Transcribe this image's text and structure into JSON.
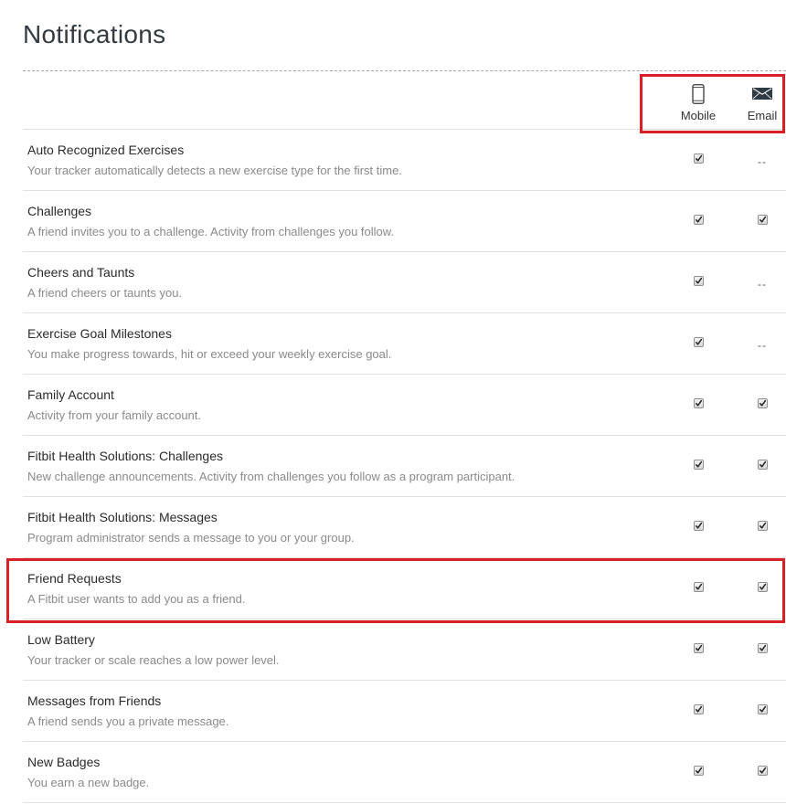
{
  "page": {
    "title": "Notifications"
  },
  "columns": {
    "mobile": {
      "label": "Mobile",
      "icon": "mobile-phone-icon"
    },
    "email": {
      "label": "Email",
      "icon": "envelope-icon"
    }
  },
  "colors": {
    "highlight": "#d92027",
    "row_divider": "#e1e1e1",
    "description_text": "#8a8a8a"
  },
  "rows": [
    {
      "title": "Auto Recognized Exercises",
      "description": "Your tracker automatically detects a new exercise type for the first time.",
      "mobile": "checked",
      "email": "--"
    },
    {
      "title": "Challenges",
      "description": "A friend invites you to a challenge. Activity from challenges you follow.",
      "mobile": "checked",
      "email": "checked"
    },
    {
      "title": "Cheers and Taunts",
      "description": "A friend cheers or taunts you.",
      "mobile": "checked",
      "email": "--"
    },
    {
      "title": "Exercise Goal Milestones",
      "description": "You make progress towards, hit or exceed your weekly exercise goal.",
      "mobile": "checked",
      "email": "--"
    },
    {
      "title": "Family Account",
      "description": "Activity from your family account.",
      "mobile": "checked",
      "email": "checked"
    },
    {
      "title": "Fitbit Health Solutions: Challenges",
      "description": "New challenge announcements. Activity from challenges you follow as a program participant.",
      "mobile": "checked",
      "email": "checked"
    },
    {
      "title": "Fitbit Health Solutions: Messages",
      "description": "Program administrator sends a message to you or your group.",
      "mobile": "checked",
      "email": "checked"
    },
    {
      "title": "Friend Requests",
      "description": "A Fitbit user wants to add you as a friend.",
      "mobile": "checked",
      "email": "checked"
    },
    {
      "title": "Low Battery",
      "description": "Your tracker or scale reaches a low power level.",
      "mobile": "checked",
      "email": "checked"
    },
    {
      "title": "Messages from Friends",
      "description": "A friend sends you a private message.",
      "mobile": "checked",
      "email": "checked"
    },
    {
      "title": "New Badges",
      "description": "You earn a new badge.",
      "mobile": "checked",
      "email": "checked"
    }
  ]
}
